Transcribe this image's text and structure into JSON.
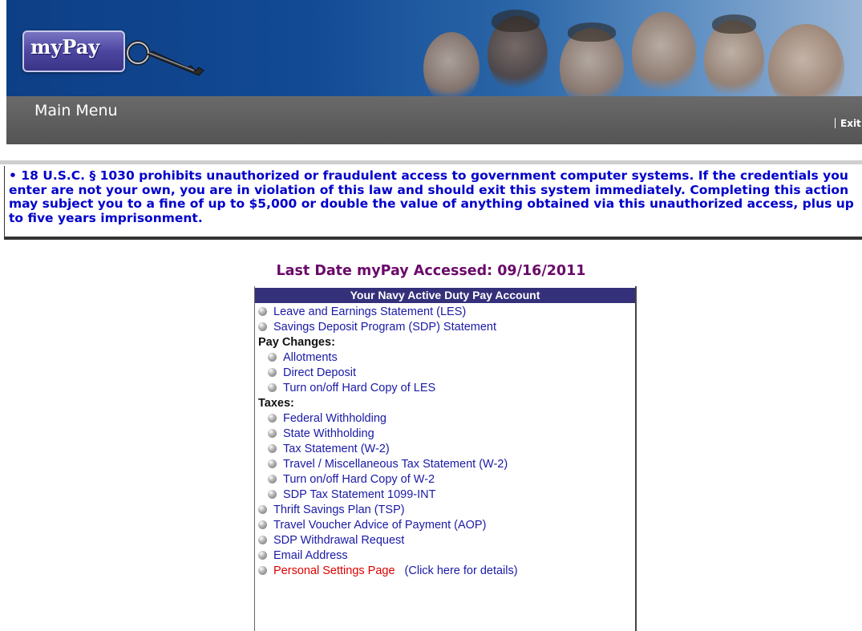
{
  "header": {
    "logo_text": "myPay",
    "menu_title": "Main Menu",
    "exit_label": "Exit"
  },
  "notice": {
    "text": "• 18 U.S.C. § 1030 prohibits unauthorized or fraudulent access to government computer systems. If the credentials you enter are not your own, you are in violation of this law and should exit this system immediately. Completing this action may subject you to a fine of up to $5,000 or double the value of anything obtained via this unauthorized access, plus up to five years imprisonment."
  },
  "last_accessed": "Last Date myPay Accessed: 09/16/2011",
  "account": {
    "title": "Your Navy Active Duty Pay Account",
    "items_top": [
      "Leave and Earnings Statement (LES)",
      "Savings Deposit Program (SDP) Statement"
    ],
    "pay_changes_label": "Pay Changes:",
    "pay_changes": [
      "Allotments",
      "Direct Deposit",
      "Turn on/off Hard Copy of LES"
    ],
    "taxes_label": "Taxes:",
    "taxes": [
      "Federal Withholding",
      "State Withholding",
      "Tax Statement (W-2)",
      "Travel / Miscellaneous Tax Statement (W-2)",
      "Turn on/off Hard Copy of W-2",
      "SDP Tax Statement 1099-INT"
    ],
    "items_bottom": [
      "Thrift Savings Plan (TSP)",
      "Travel Voucher Advice of Payment (AOP)",
      "SDP Withdrawal Request",
      "Email Address"
    ],
    "personal_settings": "Personal Settings Page",
    "personal_settings_details": "(Click here for details)"
  },
  "colors": {
    "banner_blue": "#124a94",
    "menu_bar_grey": "#5e5e5e",
    "notice_text": "#0000cc",
    "last_accessed_text": "#6a0a6a",
    "panel_header": "#35307a",
    "link": "#1a1aa6",
    "link_highlight": "#e00000"
  }
}
